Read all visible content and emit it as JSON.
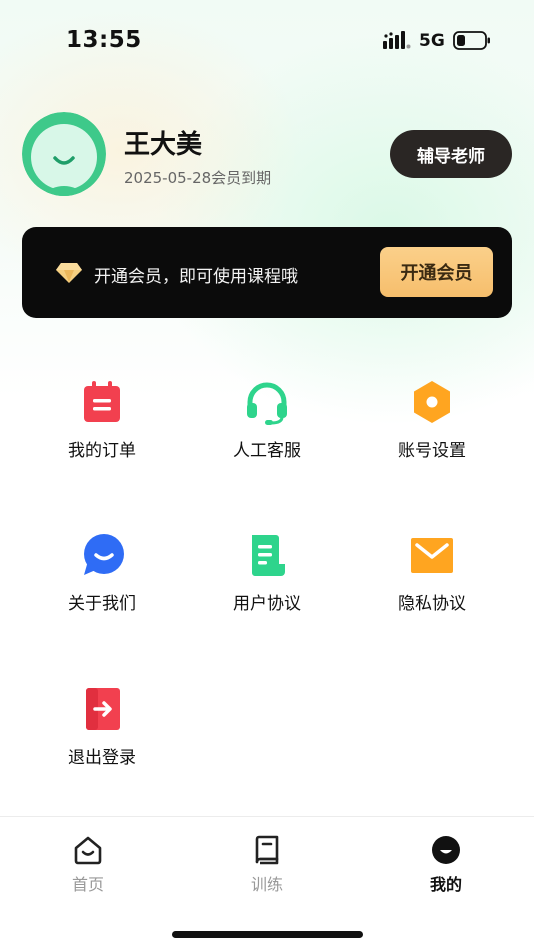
{
  "status_bar": {
    "time": "13:55",
    "network": "5G"
  },
  "profile": {
    "name": "王大美",
    "expire_text": "2025-05-28会员到期",
    "tutor_button": "辅导老师",
    "avatar_icon": "smiley-avatar-icon",
    "avatar_color": "#3ec98a"
  },
  "vip_banner": {
    "icon": "diamond-icon",
    "text": "开通会员，即可使用课程哦",
    "button": "开通会员",
    "button_color": "#f8c575"
  },
  "menu": {
    "items": [
      {
        "label": "我的订单",
        "icon": "calendar-order-icon",
        "color": "#f2404f"
      },
      {
        "label": "人工客服",
        "icon": "headset-icon",
        "color": "#2ed48c"
      },
      {
        "label": "账号设置",
        "icon": "hexagon-settings-icon",
        "color": "#ffa520"
      },
      {
        "label": "关于我们",
        "icon": "chat-bubble-icon",
        "color": "#2f6cf5"
      },
      {
        "label": "用户协议",
        "icon": "document-icon",
        "color": "#2ed48c"
      },
      {
        "label": "隐私协议",
        "icon": "envelope-icon",
        "color": "#ffa520"
      },
      {
        "label": "退出登录",
        "icon": "logout-icon",
        "color": "#f2404f"
      }
    ]
  },
  "tab_bar": {
    "tabs": [
      {
        "label": "首页",
        "icon": "home-icon",
        "active": false
      },
      {
        "label": "训练",
        "icon": "book-icon",
        "active": false
      },
      {
        "label": "我的",
        "icon": "profile-face-icon",
        "active": true
      }
    ]
  }
}
